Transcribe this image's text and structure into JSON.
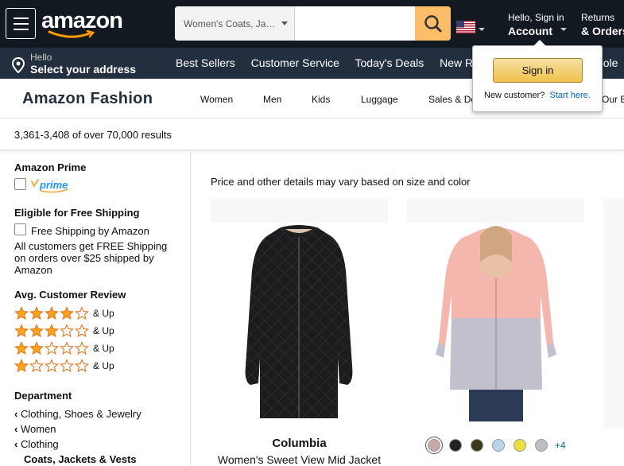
{
  "header": {
    "logo_text": "amazon",
    "search_category": "Women's Coats, Ja…",
    "search_placeholder": "",
    "account_line1": "Hello, Sign in",
    "account_line2": "Account",
    "returns_line1": "Returns",
    "returns_line2": "& Orders",
    "colors": {
      "nav_bg": "#131921",
      "subnav_bg": "#232f3e",
      "search_button": "#febd69"
    }
  },
  "subnav": {
    "hello": "Hello",
    "address": "Select your address",
    "links": [
      "Best Sellers",
      "Customer Service",
      "Today's Deals",
      "New R",
      "hole"
    ]
  },
  "fashion": {
    "title": "Amazon Fashion",
    "links": [
      "Women",
      "Men",
      "Kids",
      "Luggage",
      "Sales & De",
      "Our B"
    ]
  },
  "results": {
    "text": "3,361-3,408 of over 70,000 results"
  },
  "sidebar": {
    "prime_heading": "Amazon Prime",
    "prime_logo": "prime",
    "shipping_heading": "Eligible for Free Shipping",
    "free_shipping_label": "Free Shipping by Amazon",
    "shipping_note": "All customers get FREE Shipping on orders over $25 shipped by Amazon",
    "review_heading": "Avg. Customer Review",
    "ratings": [
      4,
      3,
      2,
      1
    ],
    "and_up": "& Up",
    "dept_heading": "Department",
    "dept_items": [
      "Clothing, Shoes & Jewelry",
      "Women",
      "Clothing"
    ],
    "dept_current": "Coats, Jackets & Vests"
  },
  "main": {
    "note": "Price and other details may vary based on size and color",
    "product1": {
      "brand": "Columbia",
      "title": "Women's Sweet View Mid Jacket"
    },
    "product2": {
      "swatches": [
        "#c9a9a6",
        "#222222",
        "#3d3a1e",
        "#b7d4ea",
        "#ecde3c",
        "#bdbdc3"
      ],
      "more": "+4"
    }
  },
  "popup": {
    "signin": "Sign in",
    "new_customer": "New customer?",
    "start_here": "Start here."
  }
}
